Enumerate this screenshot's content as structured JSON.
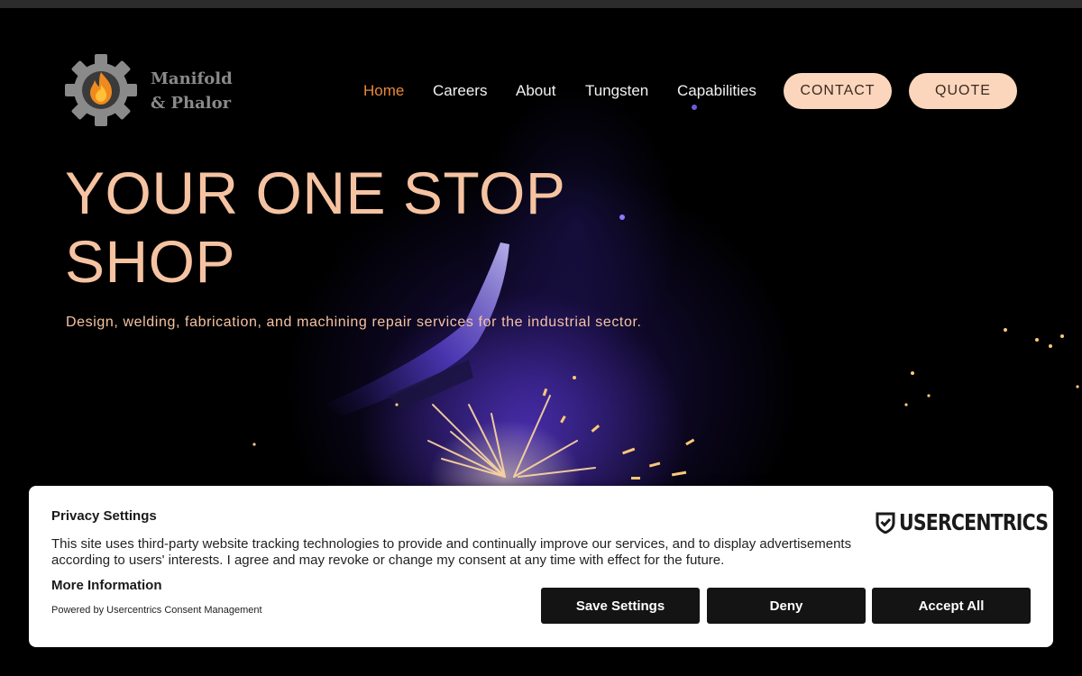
{
  "brand": {
    "name_line1": "Manifold",
    "name_line2": "& Phalor",
    "logo_icon": "gear-flame-icon",
    "accent_color": "#e8883a",
    "peach_color": "#f6c3a2"
  },
  "nav": {
    "items": [
      {
        "label": "Home",
        "active": true
      },
      {
        "label": "Careers",
        "active": false
      },
      {
        "label": "About",
        "active": false
      },
      {
        "label": "Tungsten",
        "active": false
      },
      {
        "label": "Capabilities",
        "active": false
      }
    ],
    "contact_label": "CONTACT",
    "quote_label": "QUOTE"
  },
  "hero": {
    "title_line1": "YOUR ONE STOP",
    "title_line2": "SHOP",
    "subtitle": "Design, welding, fabrication, and machining repair services for the industrial sector."
  },
  "consent": {
    "title": "Privacy Settings",
    "body": "This site uses third-party website tracking technologies to provide and continually improve our services, and to display advertisements according to users' interests. I agree and may revoke or change my consent at any time with effect for the future.",
    "more_info": "More Information",
    "powered_by": "Powered by Usercentrics Consent Management",
    "logo_text": "USERCENTRICS",
    "buttons": {
      "save": "Save Settings",
      "deny": "Deny",
      "accept": "Accept All"
    }
  }
}
